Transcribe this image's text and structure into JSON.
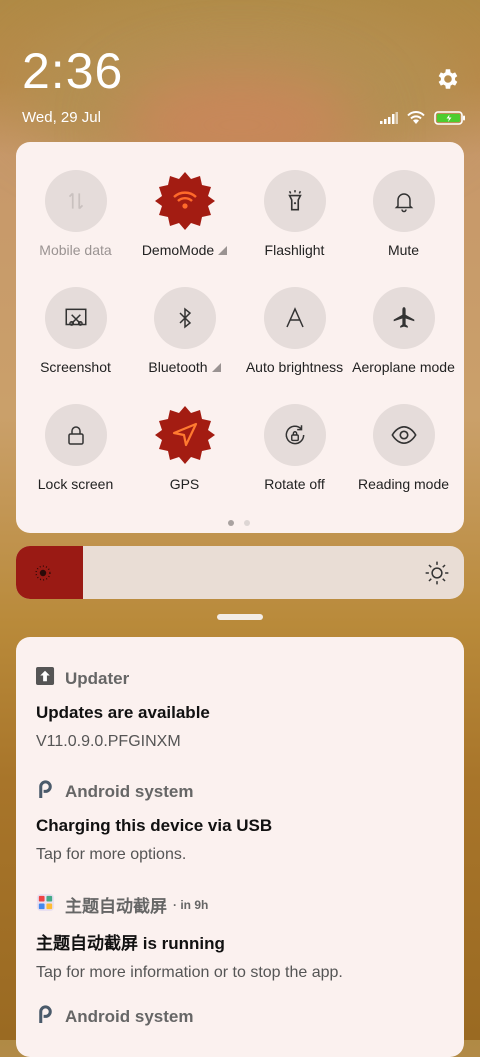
{
  "status_bar": {
    "time": "2:36",
    "date": "Wed, 29 Jul"
  },
  "quick_settings": [
    {
      "label": "Mobile data",
      "icon": "mobile-data-icon",
      "active": false,
      "dim": true
    },
    {
      "label": "DemoMode",
      "icon": "wifi-icon",
      "active": true,
      "expandable": true
    },
    {
      "label": "Flashlight",
      "icon": "flashlight-icon",
      "active": false
    },
    {
      "label": "Mute",
      "icon": "bell-icon",
      "active": false
    },
    {
      "label": "Screenshot",
      "icon": "screenshot-icon",
      "active": false
    },
    {
      "label": "Bluetooth",
      "icon": "bluetooth-icon",
      "active": false,
      "expandable": true
    },
    {
      "label": "Auto brightness",
      "icon": "auto-brightness-icon",
      "active": false
    },
    {
      "label": "Aeroplane mode",
      "icon": "airplane-icon",
      "active": false
    },
    {
      "label": "Lock screen",
      "icon": "lock-icon",
      "active": false
    },
    {
      "label": "GPS",
      "icon": "location-arrow-icon",
      "active": true
    },
    {
      "label": "Rotate off",
      "icon": "rotate-lock-icon",
      "active": false
    },
    {
      "label": "Reading mode",
      "icon": "eye-icon",
      "active": false
    }
  ],
  "brightness": {
    "level": 0.15
  },
  "accent_color": "#9a1a14",
  "notifications": [
    {
      "app": "Updater",
      "title": "Updates are available",
      "text": "V11.0.9.0.PFGINXM",
      "icon": "updater-icon"
    },
    {
      "app": "Android system",
      "title": "Charging this device via USB",
      "text": "Tap for more options.",
      "icon": "android-system-icon"
    },
    {
      "app": "主题自动截屏",
      "meta": "· in 9h",
      "title": "主题自动截屏 is running",
      "text": "Tap for more information or to stop the app.",
      "icon": "theme-app-icon"
    },
    {
      "app": "Android system",
      "icon": "android-system-icon"
    }
  ]
}
